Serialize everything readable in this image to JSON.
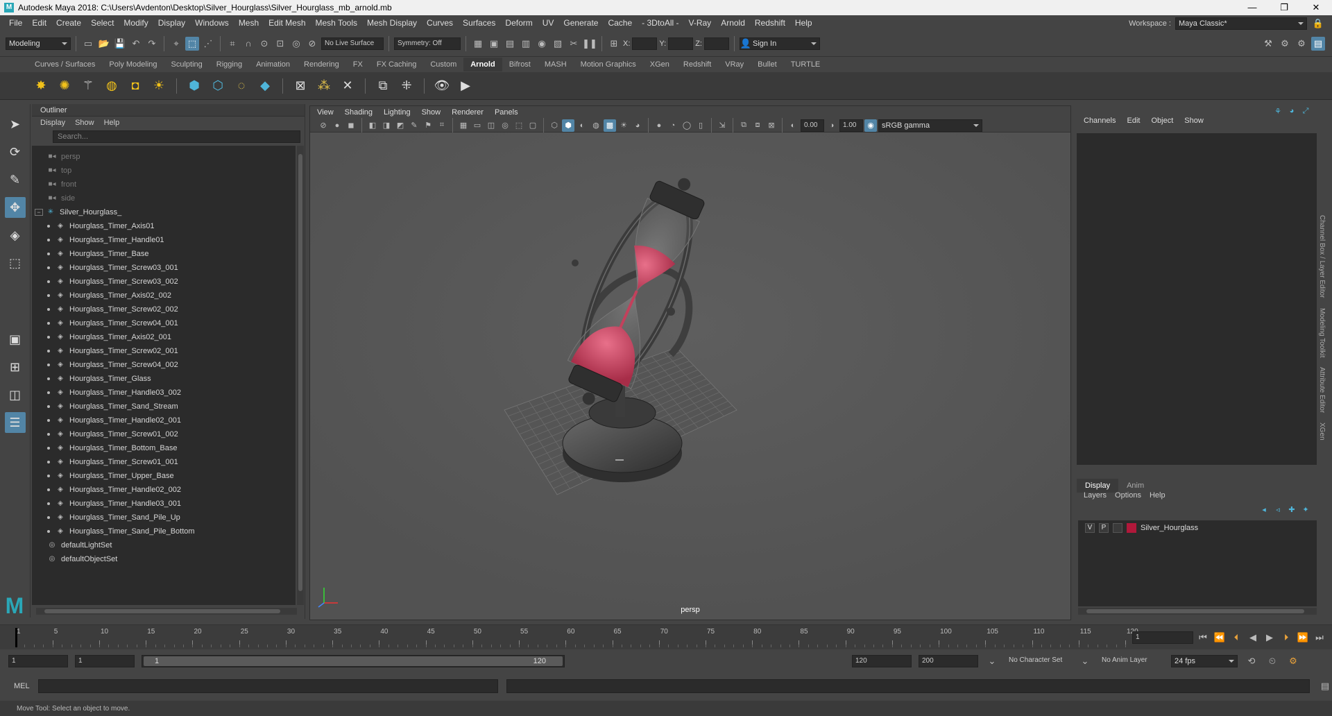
{
  "window": {
    "title": "Autodesk Maya 2018: C:\\Users\\Avdenton\\Desktop\\Silver_Hourglass\\Silver_Hourglass_mb_arnold.mb",
    "controls": [
      "—",
      "❐",
      "✕"
    ]
  },
  "menubar": {
    "items": [
      "File",
      "Edit",
      "Create",
      "Select",
      "Modify",
      "Display",
      "Windows",
      "Mesh",
      "Edit Mesh",
      "Mesh Tools",
      "Mesh Display",
      "Curves",
      "Surfaces",
      "Deform",
      "UV",
      "Generate",
      "Cache",
      "- 3DtoAll -",
      "V-Ray",
      "Arnold",
      "Redshift",
      "Help"
    ],
    "workspace_label": "Workspace :",
    "workspace_value": "Maya Classic*"
  },
  "statusline": {
    "mode": "Modeling",
    "live_surface": "No Live Surface",
    "symmetry": "Symmetry: Off",
    "x_label": "X:",
    "y_label": "Y:",
    "z_label": "Z:",
    "sign_in": "Sign In"
  },
  "shelf": {
    "tabs": [
      "Curves / Surfaces",
      "Poly Modeling",
      "Sculpting",
      "Rigging",
      "Animation",
      "Rendering",
      "FX",
      "FX Caching",
      "Custom",
      "Arnold",
      "Bifrost",
      "MASH",
      "Motion Graphics",
      "XGen",
      "Redshift",
      "VRay",
      "Bullet",
      "TURTLE"
    ],
    "active_tab": "Arnold"
  },
  "outliner": {
    "title": "Outliner",
    "menu": [
      "Display",
      "Show",
      "Help"
    ],
    "search_placeholder": "Search...",
    "cameras": [
      "persp",
      "top",
      "front",
      "side"
    ],
    "group": "Silver_Hourglass_",
    "children": [
      "Hourglass_Timer_Axis01",
      "Hourglass_Timer_Handle01",
      "Hourglass_Timer_Base",
      "Hourglass_Timer_Screw03_001",
      "Hourglass_Timer_Screw03_002",
      "Hourglass_Timer_Axis02_002",
      "Hourglass_Timer_Screw02_002",
      "Hourglass_Timer_Screw04_001",
      "Hourglass_Timer_Axis02_001",
      "Hourglass_Timer_Screw02_001",
      "Hourglass_Timer_Screw04_002",
      "Hourglass_Timer_Glass",
      "Hourglass_Timer_Handle03_002",
      "Hourglass_Timer_Sand_Stream",
      "Hourglass_Timer_Handle02_001",
      "Hourglass_Timer_Screw01_002",
      "Hourglass_Timer_Bottom_Base",
      "Hourglass_Timer_Screw01_001",
      "Hourglass_Timer_Upper_Base",
      "Hourglass_Timer_Handle02_002",
      "Hourglass_Timer_Handle03_001",
      "Hourglass_Timer_Sand_Pile_Up",
      "Hourglass_Timer_Sand_Pile_Bottom"
    ],
    "sets": [
      "defaultLightSet",
      "defaultObjectSet"
    ]
  },
  "viewport": {
    "menu": [
      "View",
      "Shading",
      "Lighting",
      "Show",
      "Renderer",
      "Panels"
    ],
    "exposure": "0.00",
    "gamma": "1.00",
    "color_space": "sRGB gamma",
    "camera_label": "persp"
  },
  "channelbox": {
    "menu": [
      "Channels",
      "Edit",
      "Object",
      "Show"
    ],
    "side_tabs": [
      "Channel Box / Layer Editor",
      "Modeling Toolkit",
      "Attribute Editor",
      "XGen"
    ]
  },
  "layers": {
    "tabs": [
      "Display",
      "Anim"
    ],
    "active_tab": "Display",
    "menu": [
      "Layers",
      "Options",
      "Help"
    ],
    "rows": [
      {
        "v": "V",
        "p": "P",
        "name": "Silver_Hourglass",
        "color": "#b0183a"
      }
    ]
  },
  "timeline": {
    "ticks": [
      "1",
      "5",
      "10",
      "15",
      "20",
      "25",
      "30",
      "35",
      "40",
      "45",
      "50",
      "55",
      "60",
      "65",
      "70",
      "75",
      "80",
      "85",
      "90",
      "95",
      "100",
      "105",
      "110",
      "115",
      "120"
    ],
    "current_frame": "1"
  },
  "range": {
    "start": "1",
    "playback_start": "1",
    "slider_start": "1",
    "slider_end": "120",
    "playback_end": "120",
    "end": "200",
    "character_set": "No Character Set",
    "anim_layer": "No Anim Layer",
    "fps": "24 fps"
  },
  "commandline": {
    "label": "MEL"
  },
  "helpline": {
    "text": "Move Tool: Select an object to move."
  }
}
